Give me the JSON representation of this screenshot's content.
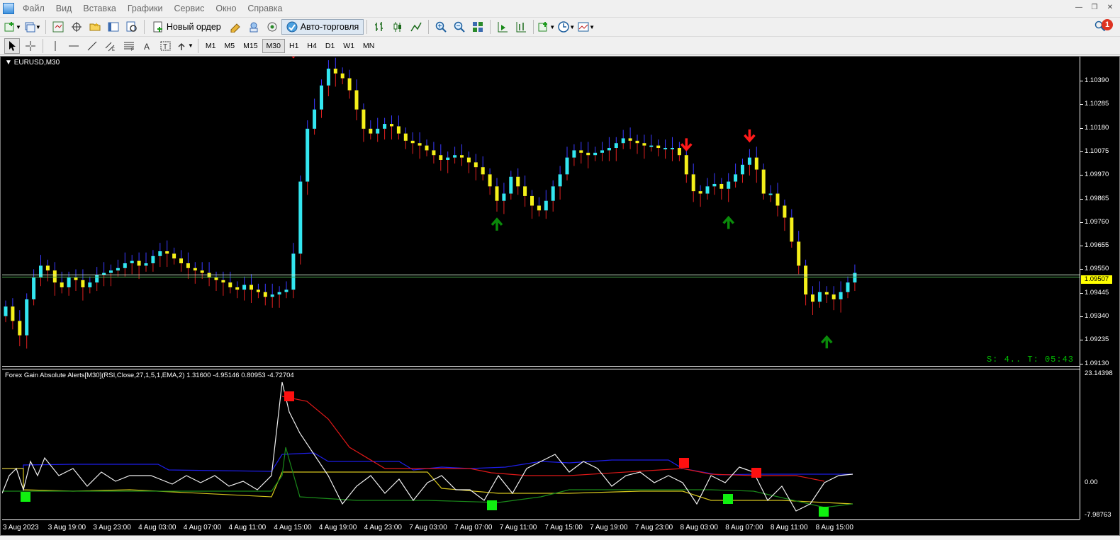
{
  "menu": [
    "Файл",
    "Вид",
    "Вставка",
    "Графики",
    "Сервис",
    "Окно",
    "Справка"
  ],
  "toolbar": {
    "new_order_label": "Новый ордер",
    "autotrade_label": "Авто-торговля",
    "notification_count": "1"
  },
  "timeframes": [
    "M1",
    "M5",
    "M15",
    "M30",
    "H1",
    "H4",
    "D1",
    "W1",
    "MN"
  ],
  "active_timeframe": "M30",
  "chart": {
    "symbol_title": "EURUSD,M30",
    "current_price": "1.09507",
    "price_ticks": [
      "1.10390",
      "1.10285",
      "1.10180",
      "1.10075",
      "1.09970",
      "1.09865",
      "1.09760",
      "1.09655",
      "1.09550",
      "1.09445",
      "1.09340",
      "1.09235",
      "1.09130"
    ],
    "timer_text": "S: 4.. T: 05:43"
  },
  "indicator": {
    "title": "Forex Gain Absolute Alerts[M30](RSI,Close,27,1,5,1,EMA,2) 1.31600 -4.95146 0.80953 -4.72704",
    "axis_ticks": [
      "23.14398",
      "0.00",
      "-7.98763"
    ]
  },
  "time_labels": [
    "3 Aug 2023",
    "3 Aug 19:00",
    "3 Aug 23:00",
    "4 Aug 03:00",
    "4 Aug 07:00",
    "4 Aug 11:00",
    "4 Aug 15:00",
    "4 Aug 19:00",
    "4 Aug 23:00",
    "7 Aug 03:00",
    "7 Aug 07:00",
    "7 Aug 11:00",
    "7 Aug 15:00",
    "7 Aug 19:00",
    "7 Aug 23:00",
    "8 Aug 03:00",
    "8 Aug 07:00",
    "8 Aug 11:00",
    "8 Aug 15:00"
  ],
  "colors": {
    "bull": "#33e6f0",
    "bear": "#f5f01a",
    "wick_up": "#3a3aff",
    "wick_down": "#e02020",
    "sell_arrow": "#ff1a1a",
    "buy_arrow": "#0a8a0a",
    "price_line": "#4caf50"
  },
  "chart_data": {
    "type": "candlestick",
    "symbol": "EURUSD",
    "timeframe": "M30",
    "ylim": [
      1.0913,
      1.1042
    ],
    "current_price": 1.09507,
    "closes": [
      1.0938,
      1.0932,
      1.0926,
      1.0941,
      1.095,
      1.0955,
      1.0953,
      1.0948,
      1.0946,
      1.095,
      1.0949,
      1.0946,
      1.0948,
      1.0951,
      1.0952,
      1.0953,
      1.0954,
      1.0956,
      1.0957,
      1.0955,
      1.0956,
      1.0959,
      1.0961,
      1.096,
      1.0958,
      1.0956,
      1.0954,
      1.0953,
      1.0952,
      1.095,
      1.0949,
      1.0948,
      1.0946,
      1.0945,
      1.0947,
      1.0945,
      1.0944,
      1.0942,
      1.0943,
      1.0944,
      1.0945,
      1.096,
      1.099,
      1.1012,
      1.102,
      1.103,
      1.1037,
      1.1035,
      1.1033,
      1.1028,
      1.102,
      1.1012,
      1.101,
      1.1012,
      1.1014,
      1.1013,
      1.101,
      1.1007,
      1.1006,
      1.1005,
      1.1003,
      1.1001,
      1.0999,
      1.1,
      1.1001,
      1.1,
      1.0998,
      1.0996,
      1.0993,
      1.0988,
      1.0982,
      1.0985,
      1.0992,
      1.0988,
      1.0984,
      1.098,
      1.0978,
      1.0982,
      1.0988,
      1.0993,
      1.1,
      1.1003,
      1.1002,
      1.1001,
      1.1002,
      1.1003,
      1.1004,
      1.1006,
      1.1008,
      1.1007,
      1.1006,
      1.1005,
      1.1005,
      1.1004,
      1.1004,
      1.1004,
      1.1001,
      1.0993,
      1.0986,
      1.0985,
      1.0988,
      1.0989,
      1.0987,
      1.099,
      1.0993,
      1.0997,
      1.1,
      1.0995,
      1.0985,
      1.0985,
      1.098,
      1.0975,
      1.0965,
      1.0955,
      1.0943,
      1.094,
      1.0944,
      1.0943,
      1.0941,
      1.0944,
      1.0948,
      1.0952
    ]
  }
}
